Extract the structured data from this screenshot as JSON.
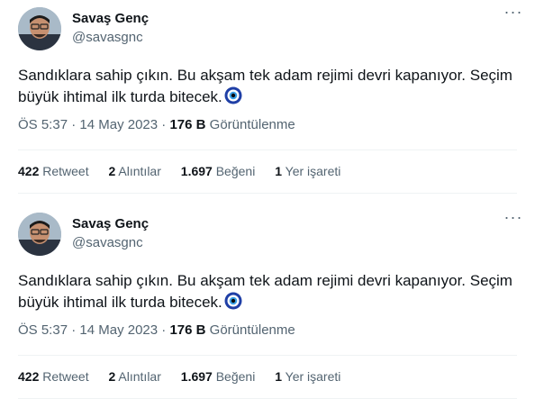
{
  "tweets": [
    {
      "author_name": "Savaş Genç",
      "author_handle": "@savasgnc",
      "more_icon": "more-icon",
      "text": "Sandıklara sahip çıkın. Bu akşam tek adam rejimi devri kapanıyor. Seçim büyük ihtimal ilk turda bitecek.",
      "emoji": "nazar-amulet",
      "time": "ÖS 5:37",
      "dot": "·",
      "date": "14 May 2023",
      "views_value": "176 B",
      "views_label": "Görüntülenme",
      "stats": {
        "retweets_value": "422",
        "retweets_label": "Retweet",
        "quotes_value": "2",
        "quotes_label": "Alıntılar",
        "likes_value": "1.697",
        "likes_label": "Beğeni",
        "bookmarks_value": "1",
        "bookmarks_label": "Yer işareti"
      }
    },
    {
      "author_name": "Savaş Genç",
      "author_handle": "@savasgnc",
      "more_icon": "more-icon",
      "text": "Sandıklara sahip çıkın. Bu akşam tek adam rejimi devri kapanıyor. Seçim büyük ihtimal ilk turda bitecek.",
      "emoji": "nazar-amulet",
      "time": "ÖS 5:37",
      "dot": "·",
      "date": "14 May 2023",
      "views_value": "176 B",
      "views_label": "Görüntülenme",
      "stats": {
        "retweets_value": "422",
        "retweets_label": "Retweet",
        "quotes_value": "2",
        "quotes_label": "Alıntılar",
        "likes_value": "1.697",
        "likes_label": "Beğeni",
        "bookmarks_value": "1",
        "bookmarks_label": "Yer işareti"
      }
    }
  ]
}
